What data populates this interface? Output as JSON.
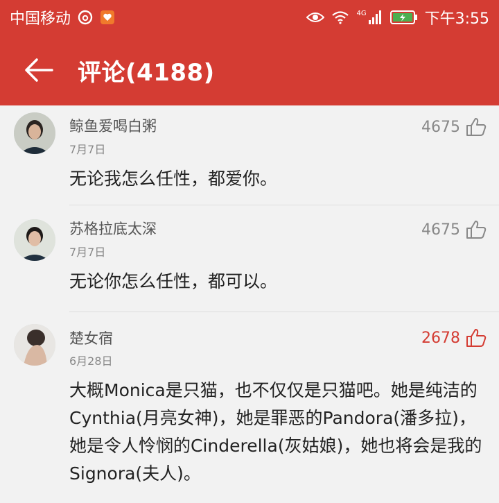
{
  "status_bar": {
    "carrier": "中国移动",
    "network": "4G",
    "time": "下午3:55",
    "icons": [
      "netease-music-icon",
      "app-notification-icon",
      "eye-icon",
      "wifi-icon",
      "signal-icon",
      "battery-icon"
    ]
  },
  "header": {
    "title": "评论(4188)",
    "back_icon": "back-arrow-icon",
    "background": "#d43c33"
  },
  "comments": [
    {
      "user": "鲸鱼爱喝白粥",
      "date": "7月7日",
      "likes": "4675",
      "liked": false,
      "text": "无论我怎么任性，都爱你。"
    },
    {
      "user": "苏格拉底太深",
      "date": "7月7日",
      "likes": "4675",
      "liked": false,
      "text": "无论你怎么任性，都可以。"
    },
    {
      "user": "楚女宿",
      "date": "6月28日",
      "likes": "2678",
      "liked": true,
      "text": "大概Monica是只猫，也不仅仅是只猫吧。她是纯洁的Cynthia(月亮女神)，她是罪恶的Pandora(潘多拉)，她是令人怜悯的Cinderella(灰姑娘)，她也将会是我的Signora(夫人)。"
    }
  ],
  "colors": {
    "accent": "#d43c33",
    "liked": "#d43c33",
    "meta_text": "#888888"
  }
}
